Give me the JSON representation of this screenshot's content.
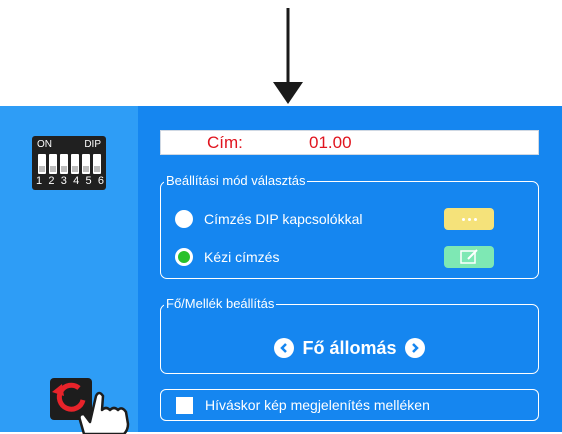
{
  "address": {
    "label": "Cím:",
    "value": "01.00"
  },
  "dip": {
    "on_label": "ON",
    "dip_label": "DIP",
    "numbers": [
      "1",
      "2",
      "3",
      "4",
      "5",
      "6"
    ]
  },
  "mode_group": {
    "title": "Beállítási mód választás",
    "options": [
      {
        "label": "Címzés DIP kapcsolókkal",
        "selected": false
      },
      {
        "label": "Kézi címzés",
        "selected": true
      }
    ]
  },
  "station_group": {
    "title": "Fő/Mellék beállítás",
    "value": "Fő állomás"
  },
  "display_option": {
    "label": "Híváskor kép megjelenítés melléken",
    "checked": false
  },
  "colors": {
    "panel": "#1586f0",
    "sidebar": "#2e9df6",
    "address_text": "#e0141e",
    "selected_radio": "#2ac12a",
    "dots_button": "#f5e27a",
    "edit_button": "#7ee8b4"
  },
  "icons": {
    "pointer": "down-arrow-icon",
    "dip": "dip-switch-icon",
    "reset": "reset-hand-icon",
    "more": "more-dots-icon",
    "edit": "edit-icon",
    "prev": "chevron-left-icon",
    "next": "chevron-right-icon"
  }
}
